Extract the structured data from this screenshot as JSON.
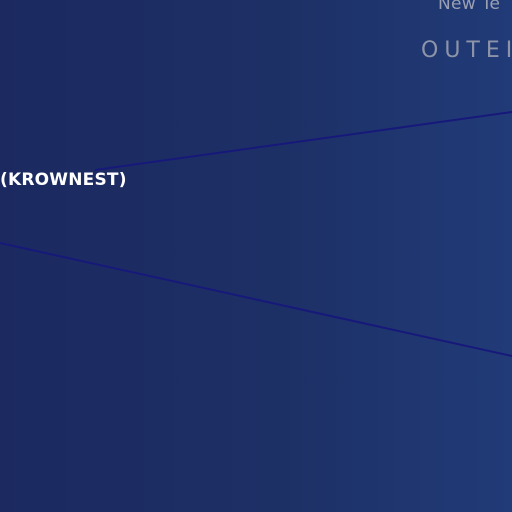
{
  "header": {
    "subtitle": "New Te",
    "title": "OUTEI"
  },
  "node": {
    "label": "(KROWNEST)"
  },
  "colors": {
    "background_left": "#1b2960",
    "background_right": "#213b78",
    "line": "#17197a",
    "label_text": "#ffffff",
    "heading_text": "#8d94a8"
  }
}
